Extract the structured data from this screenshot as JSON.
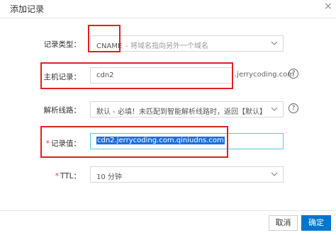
{
  "dialog": {
    "title": "添加记录",
    "close_glyph": "×"
  },
  "form": {
    "record_type": {
      "label": "记录类型：",
      "value": "CNAME",
      "hint": "- 将域名指向另外一个域名"
    },
    "host_record": {
      "label": "主机记录：",
      "value": "cdn2",
      "suffix": ".jerrycoding.com"
    },
    "resolution_line": {
      "label": "解析线路：",
      "value": "默认 - 必填！未匹配到智能解析线路时，返回【默认】线路..."
    },
    "record_value": {
      "required_mark": "*",
      "label": "记录值：",
      "value": "cdn2.jerrycoding.com.qiniudns.com"
    },
    "ttl": {
      "required_mark": "*",
      "label": "TTL：",
      "value": "10 分钟"
    }
  },
  "help_glyph": "?",
  "footer": {
    "cancel_label": "取消",
    "ok_label": "确定"
  },
  "colors": {
    "primary_button": "#0077cc",
    "annotation_red": "#e02020",
    "focus_border": "#58c6e8"
  }
}
